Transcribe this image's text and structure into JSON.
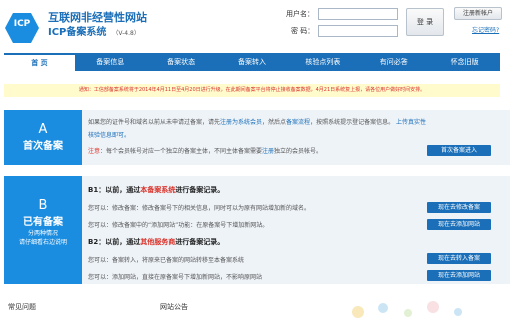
{
  "header": {
    "logo_mark": "ICP",
    "title_line1": "互联网非经营性网站",
    "title_line2": "ICP备案系统",
    "version": "（V-4.8）",
    "username_label": "用户名：",
    "password_label": "密 码：",
    "login_label": "登 录",
    "register_label": "注册新帐户",
    "forgot_label": "忘记密码?"
  },
  "nav": {
    "items": [
      "首 页",
      "备案信息",
      "备案状态",
      "备案转入",
      "核验点列表",
      "有问必答",
      "怀念旧版"
    ],
    "active_index": 0
  },
  "notice": "通知：工信部备案系统将于2014年4月11日至4月20日进行升级，在此期间备案平台将停止接收备案数据，4月21日系统复上报，请各位用户做好时间安排。",
  "section_a": {
    "letter": "A",
    "title": "首次备案",
    "line1_pre": "如果您的证件号和域名以前从未申请过备案，请先",
    "line1_link1": "注册为系统会员",
    "line1_mid": "，然后点",
    "line1_link2": "备案流程",
    "line1_post": "，按照系统提示登记备案信息。",
    "line1_link3": "上传真实性",
    "line2_link": "核验信息即可。",
    "note_label": "注意：",
    "note_text": "每个会员帐号对应一个独立的备案主体，不同主体备案需要",
    "note_link": "注册",
    "note_tail": "独立的会员帐号。",
    "button": "首次备案进入"
  },
  "section_b": {
    "letter": "B",
    "title": "已有备案",
    "sub1": "分两种情况",
    "sub2": "请仔细看右边说明",
    "b1_head_pre": "B1：以前，通过",
    "b1_head_red": "本备案系统",
    "b1_head_post": "进行备案记录。",
    "b1_l1": "您可以：修改备案：修改备案号下的相关信息，同时可以为原有网站增加新的域名。",
    "b1_l2": "您可以：修改备案中的“添加网站”功能：在原备案号下增加新网站。",
    "b2_head_pre": "B2：以前，通过",
    "b2_head_red": "其他服务商",
    "b2_head_post": "进行备案记录。",
    "b2_l1": "您可以：备案转入，将原来已备案的网站转移至本备案系统",
    "b2_l2": "您可以：添加网站，直接在原备案号下增加新网站，不影响原网站",
    "btn1": "现在去修改备案",
    "btn2": "现在去添加网站",
    "btn3": "现在去转入备案",
    "btn4": "现在去添加网站"
  },
  "footer": {
    "faq": "常见问题",
    "announce": "网站公告"
  },
  "colors": {
    "brand_blue": "#1b6fb8",
    "badge_blue": "#1b8de0",
    "notice_bg": "#fffbcd",
    "alert_red": "#d9342b",
    "section_bg": "#eef3f8"
  }
}
